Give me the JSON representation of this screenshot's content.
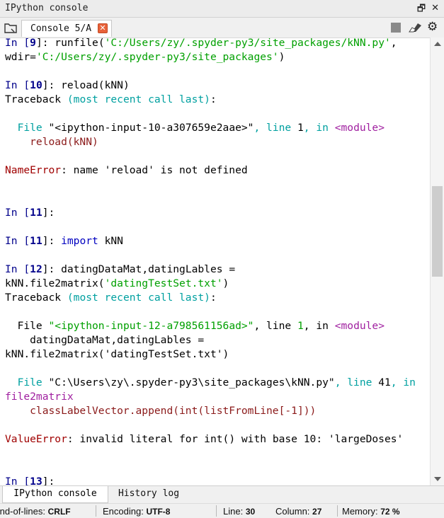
{
  "window": {
    "title": "IPython console"
  },
  "toolbar": {
    "tab_label": "Console 5/A"
  },
  "console": {
    "lines": [
      [
        {
          "t": "In [",
          "c": "p-in"
        },
        {
          "t": "9",
          "c": "p-num"
        },
        {
          "t": "]: runfile(",
          "c": ""
        },
        {
          "t": "'C:/Users/zy/.spyder-py3/site_packages/kNN.py'",
          "c": "str"
        },
        {
          "t": ",",
          "c": ""
        }
      ],
      [
        {
          "t": "wdir=",
          "c": ""
        },
        {
          "t": "'C:/Users/zy/.spyder-py3/site_packages'",
          "c": "str"
        },
        {
          "t": ")",
          "c": ""
        }
      ],
      [],
      [
        {
          "t": "In [",
          "c": "p-in"
        },
        {
          "t": "10",
          "c": "p-num"
        },
        {
          "t": "]: reload(kNN)",
          "c": ""
        }
      ],
      [
        {
          "t": "Traceback ",
          "c": ""
        },
        {
          "t": "(most recent call last)",
          "c": "cy"
        },
        {
          "t": ":",
          "c": ""
        }
      ],
      [],
      [
        {
          "t": "  File ",
          "c": "cy"
        },
        {
          "t": "\"<ipython-input-10-a307659e2aae>\"",
          "c": ""
        },
        {
          "t": ", line ",
          "c": "cy"
        },
        {
          "t": "1",
          "c": ""
        },
        {
          "t": ", in ",
          "c": "cy"
        },
        {
          "t": "<module>",
          "c": "mod"
        }
      ],
      [
        {
          "t": "    reload(kNN)",
          "c": "red"
        }
      ],
      [],
      [
        {
          "t": "NameError",
          "c": "err"
        },
        {
          "t": ": name 'reload' is not defined",
          "c": ""
        }
      ],
      [],
      [],
      [
        {
          "t": "In [",
          "c": "p-in"
        },
        {
          "t": "11",
          "c": "p-num"
        },
        {
          "t": "]:",
          "c": ""
        }
      ],
      [],
      [
        {
          "t": "In [",
          "c": "p-in"
        },
        {
          "t": "11",
          "c": "p-num"
        },
        {
          "t": "]: ",
          "c": ""
        },
        {
          "t": "import",
          "c": "kw"
        },
        {
          "t": " kNN",
          "c": ""
        }
      ],
      [],
      [
        {
          "t": "In [",
          "c": "p-in"
        },
        {
          "t": "12",
          "c": "p-num"
        },
        {
          "t": "]: datingDataMat,datingLables =",
          "c": ""
        }
      ],
      [
        {
          "t": "kNN.file2matrix(",
          "c": ""
        },
        {
          "t": "'datingTestSet.txt'",
          "c": "str"
        },
        {
          "t": ")",
          "c": ""
        }
      ],
      [
        {
          "t": "Traceback ",
          "c": ""
        },
        {
          "t": "(most recent call last)",
          "c": "cy"
        },
        {
          "t": ":",
          "c": ""
        }
      ],
      [],
      [
        {
          "t": "  File ",
          "c": ""
        },
        {
          "t": "\"<ipython-input-12-a798561156ad>\"",
          "c": "str"
        },
        {
          "t": ", line ",
          "c": ""
        },
        {
          "t": "1",
          "c": "str"
        },
        {
          "t": ", in ",
          "c": ""
        },
        {
          "t": "<module>",
          "c": "mod"
        }
      ],
      [
        {
          "t": "    datingDataMat,datingLables =",
          "c": ""
        }
      ],
      [
        {
          "t": "kNN.file2matrix('datingTestSet.txt')",
          "c": ""
        }
      ],
      [],
      [
        {
          "t": "  File ",
          "c": "cy"
        },
        {
          "t": "\"C:\\Users\\zy\\.spyder-py3\\site_packages\\kNN.py\"",
          "c": ""
        },
        {
          "t": ", line ",
          "c": "cy"
        },
        {
          "t": "41",
          "c": ""
        },
        {
          "t": ", in",
          "c": "cy"
        }
      ],
      [
        {
          "t": "file2matrix",
          "c": "mod"
        }
      ],
      [
        {
          "t": "    classLabelVector.append(int(listFromLine[-1]))",
          "c": "red"
        }
      ],
      [],
      [
        {
          "t": "ValueError",
          "c": "err"
        },
        {
          "t": ": invalid literal for int() with base 10: 'largeDoses'",
          "c": ""
        }
      ],
      [],
      [],
      [
        {
          "t": "In [",
          "c": "p-in"
        },
        {
          "t": "13",
          "c": "p-num"
        },
        {
          "t": "]:",
          "c": ""
        }
      ]
    ]
  },
  "bottom_tabs": {
    "console_label": "IPython console",
    "history_label": "History log"
  },
  "status": {
    "eol_label": "End-of-lines:",
    "eol_value": "CRLF",
    "encoding_label": "Encoding:",
    "encoding_value": "UTF-8",
    "line_label": "Line:",
    "line_value": "30",
    "column_label": "Column:",
    "column_value": "27",
    "memory_label": "Memory:",
    "memory_value": "72 %"
  }
}
